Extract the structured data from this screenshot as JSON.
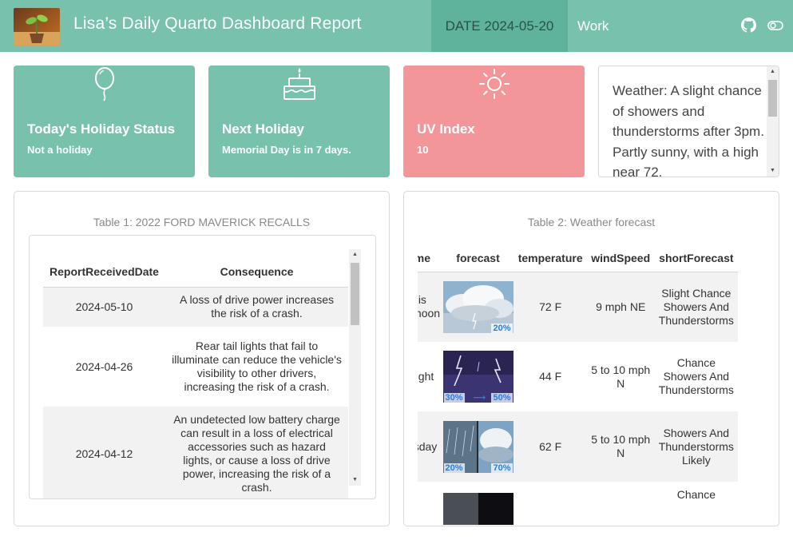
{
  "header": {
    "title": "Lisa’s Daily Quarto Dashboard Report",
    "tabs": [
      {
        "label": "DATE 2024-05-20",
        "active": true
      },
      {
        "label": "Work",
        "active": false
      }
    ],
    "icons": [
      "github-icon",
      "toggle-icon"
    ]
  },
  "value_boxes": [
    {
      "icon": "balloon-icon",
      "title": "Today's Holiday Status",
      "value": "Not a holiday",
      "color": "#78c2ad"
    },
    {
      "icon": "cake-icon",
      "title": "Next Holiday",
      "value": "Memorial Day is in 7 days.",
      "color": "#78c2ad"
    },
    {
      "icon": "sun-icon",
      "title": "UV Index",
      "value": "10",
      "color": "#f3969a"
    }
  ],
  "weather_card": {
    "text": "Weather: A slight chance of showers and thunderstorms after 3pm. Partly sunny, with a high near 72."
  },
  "recalls": {
    "caption": "Table 1: 2022 FORD MAVERICK RECALLS",
    "columns": [
      "ReportReceivedDate",
      "Consequence"
    ],
    "rows": [
      {
        "date": "2024-05-10",
        "consequence": "A loss of drive power increases the risk of a crash."
      },
      {
        "date": "2024-04-26",
        "consequence": "Rear tail lights that fail to illuminate can reduce the vehicle's visibility to other drivers, increasing the risk of a crash."
      },
      {
        "date": "2024-04-12",
        "consequence": "An undetected low battery charge can result in a loss of electrical accessories such as hazard lights, or cause a loss of drive power, increasing the risk of a crash."
      }
    ]
  },
  "forecast": {
    "caption": "Table 2: Weather forecast",
    "columns": [
      "name",
      "forecast",
      "temperature",
      "windSpeed",
      "shortForecast"
    ],
    "rows": [
      {
        "name": "This Afternoon",
        "image": "partly-cloudy-storm",
        "pct_left": "",
        "pct_right": "20%",
        "temperature": "72 F",
        "windSpeed": "9 mph NE",
        "shortForecast": "Slight Chance Showers And Thunderstorms"
      },
      {
        "name": "Tonight",
        "image": "night-lightning",
        "pct_left": "30%",
        "pct_right": "50%",
        "temperature": "44 F",
        "windSpeed": "5 to 10 mph N",
        "shortForecast": "Chance Showers And Thunderstorms"
      },
      {
        "name": "Tuesday",
        "image": "rain-then-storm",
        "pct_left": "20%",
        "pct_right": "70%",
        "temperature": "62 F",
        "windSpeed": "5 to 10 mph N",
        "shortForecast": "Showers And Thunderstorms Likely"
      },
      {
        "name": "",
        "image": "dark-storm",
        "pct_left": "",
        "pct_right": "",
        "temperature": "",
        "windSpeed": "",
        "shortForecast": "Chance"
      }
    ]
  },
  "colors": {
    "primary": "#78c2ad",
    "primary_dark": "#5fb39c",
    "danger": "#f3969a"
  }
}
